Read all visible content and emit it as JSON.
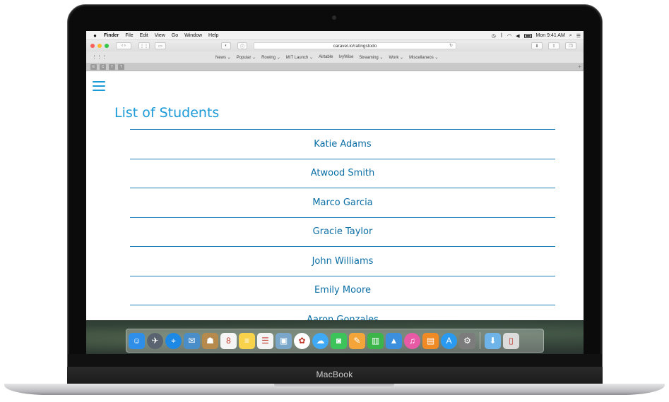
{
  "device": {
    "brand": "MacBook"
  },
  "menubar": {
    "app_name": "Finder",
    "items": [
      "File",
      "Edit",
      "View",
      "Go",
      "Window",
      "Help"
    ],
    "clock": "Mon 9:41 AM"
  },
  "browser": {
    "url": "caravel.io/ratingstodo",
    "favorites": [
      "News ⌄",
      "Popular ⌄",
      "Rowing ⌄",
      "MIT Launch ⌄",
      "Airtable",
      "IvyWise",
      "Streaming ⌄",
      "Work ⌄",
      "Miscellaneos ⌄"
    ],
    "tabs": [
      "E",
      "C",
      "T",
      "T"
    ]
  },
  "page": {
    "title": "List of Students",
    "students": [
      "Katie Adams",
      "Atwood Smith",
      "Marco Garcia",
      "Gracie Taylor",
      "John Williams",
      "Emily Moore",
      "Aaron Gonzales"
    ]
  },
  "dock": {
    "apps": [
      {
        "name": "finder-icon",
        "color": "#2f8fe8",
        "glyph": "☺"
      },
      {
        "name": "launchpad-icon",
        "color": "#5a6470",
        "glyph": "✈"
      },
      {
        "name": "safari-icon",
        "color": "#1e88e5",
        "glyph": "⌖"
      },
      {
        "name": "mail-icon",
        "color": "#4a8ec9",
        "glyph": "✉"
      },
      {
        "name": "contacts-icon",
        "color": "#b58a4c",
        "glyph": "☗"
      },
      {
        "name": "calendar-icon",
        "color": "#f5f5f5",
        "glyph": "8"
      },
      {
        "name": "notes-icon",
        "color": "#f7d24a",
        "glyph": "≡"
      },
      {
        "name": "reminders-icon",
        "color": "#f4f4f4",
        "glyph": "☰"
      },
      {
        "name": "preview-icon",
        "color": "#7aa7c9",
        "glyph": "▣"
      },
      {
        "name": "photos-icon",
        "color": "#ffffff",
        "glyph": "✿"
      },
      {
        "name": "messages-icon",
        "color": "#3fa9f5",
        "glyph": "☁"
      },
      {
        "name": "facetime-icon",
        "color": "#3cc35a",
        "glyph": "◙"
      },
      {
        "name": "pages-icon",
        "color": "#f3a53a",
        "glyph": "✎"
      },
      {
        "name": "numbers-icon",
        "color": "#3bb54a",
        "glyph": "▥"
      },
      {
        "name": "keynote-icon",
        "color": "#3c8fdc",
        "glyph": "▲"
      },
      {
        "name": "itunes-icon",
        "color": "#e95aa6",
        "glyph": "♫"
      },
      {
        "name": "ibooks-icon",
        "color": "#f08a24",
        "glyph": "▤"
      },
      {
        "name": "app-store-icon",
        "color": "#2a9af0",
        "glyph": "A"
      },
      {
        "name": "system-preferences-icon",
        "color": "#7c7c7c",
        "glyph": "⚙"
      }
    ],
    "trailing": [
      {
        "name": "downloads-folder-icon",
        "color": "#6fb4e8",
        "glyph": "⬇"
      },
      {
        "name": "trash-icon",
        "color": "#dcdcdc",
        "glyph": "▯"
      }
    ]
  }
}
